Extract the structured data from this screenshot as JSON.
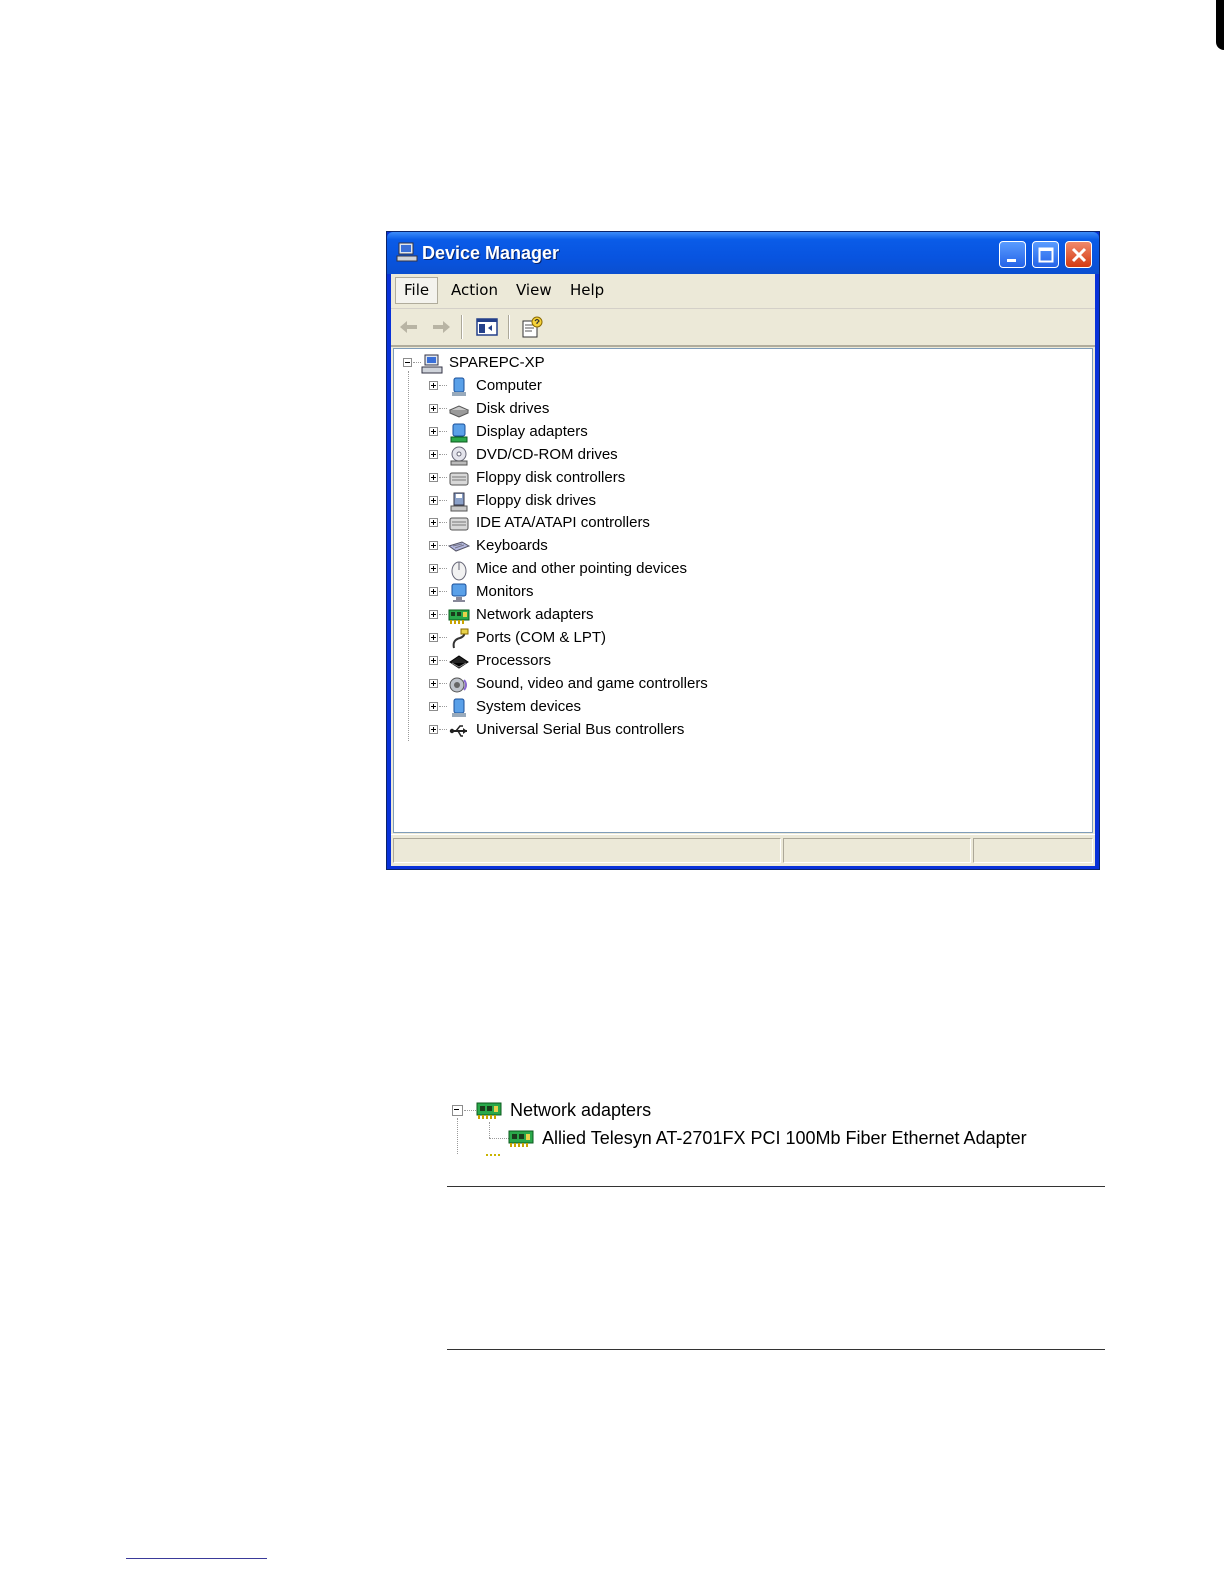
{
  "window": {
    "title": "Device Manager",
    "menu": [
      "File",
      "Action",
      "View",
      "Help"
    ],
    "toolbar": {
      "back": "back-arrow-icon",
      "forward": "forward-arrow-icon",
      "show_hide_tree": "console-tree-icon",
      "properties": "properties-icon"
    },
    "tree": {
      "root": "SPAREPC-XP",
      "categories": [
        {
          "label": "Computer",
          "icon": "computer-icon"
        },
        {
          "label": "Disk drives",
          "icon": "disk-drive-icon"
        },
        {
          "label": "Display adapters",
          "icon": "display-adapter-icon"
        },
        {
          "label": "DVD/CD-ROM drives",
          "icon": "cdrom-icon"
        },
        {
          "label": "Floppy disk controllers",
          "icon": "controller-icon"
        },
        {
          "label": "Floppy disk drives",
          "icon": "floppy-icon"
        },
        {
          "label": "IDE ATA/ATAPI controllers",
          "icon": "controller-icon"
        },
        {
          "label": "Keyboards",
          "icon": "keyboard-icon"
        },
        {
          "label": "Mice and other pointing devices",
          "icon": "mouse-icon"
        },
        {
          "label": "Monitors",
          "icon": "monitor-icon"
        },
        {
          "label": "Network adapters",
          "icon": "network-card-icon"
        },
        {
          "label": "Ports (COM & LPT)",
          "icon": "port-icon"
        },
        {
          "label": "Processors",
          "icon": "processor-icon"
        },
        {
          "label": "Sound, video and game controllers",
          "icon": "sound-icon"
        },
        {
          "label": "System devices",
          "icon": "system-icon"
        },
        {
          "label": "Universal Serial Bus controllers",
          "icon": "usb-icon"
        }
      ]
    }
  },
  "snippet": {
    "category": "Network adapters",
    "device": "Allied Telesyn AT-2701FX PCI 100Mb Fiber Ethernet Adapter"
  },
  "colors": {
    "titlebar": "#0a5ce8",
    "window_face": "#ece9d8",
    "close_button": "#d43a12"
  }
}
